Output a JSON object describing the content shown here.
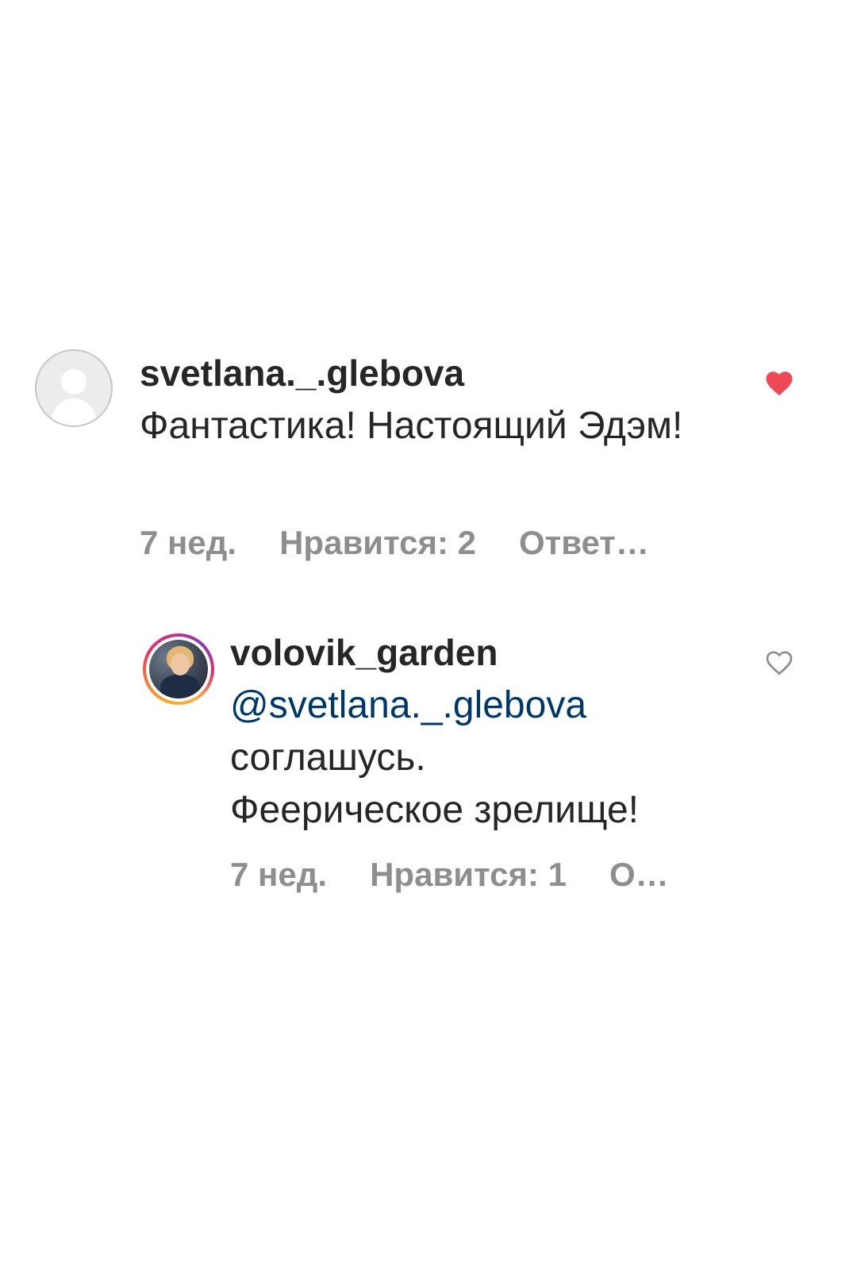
{
  "comments": [
    {
      "username": "svetlana._.glebova",
      "text": "Фантастика! Настоящий Эдэм!",
      "age": "7 нед.",
      "likes": "Нравится: 2",
      "reply": "Ответ…",
      "liked": true,
      "avatar": "default-avatar-icon"
    },
    {
      "username": "volovik_garden",
      "mention": "@svetlana._.glebova",
      "text_line1": "соглашусь.",
      "text_line2": "Феерическое зрелище!",
      "age": "7 нед.",
      "likes": "Нравится: 1",
      "reply": "О…",
      "liked": false,
      "avatar": "profile-photo"
    }
  ],
  "colors": {
    "heart_liked": "#ed4956",
    "heart_outline": "#8e8e8e",
    "mention": "#00376b",
    "meta_text": "#8e8e8e"
  }
}
